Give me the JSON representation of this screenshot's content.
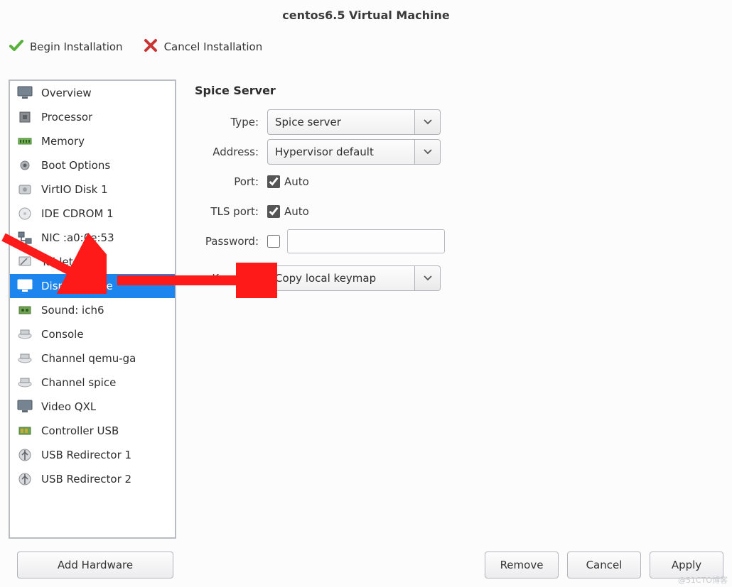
{
  "title": "centos6.5 Virtual Machine",
  "toolbar": {
    "begin_label": "Begin Installation",
    "cancel_label": "Cancel Installation"
  },
  "sidebar": {
    "items": [
      {
        "label": "Overview"
      },
      {
        "label": "Processor"
      },
      {
        "label": "Memory"
      },
      {
        "label": "Boot Options"
      },
      {
        "label": "VirtIO Disk 1"
      },
      {
        "label": "IDE CDROM 1"
      },
      {
        "label": "NIC :a0:0e:53"
      },
      {
        "label": "Tablet"
      },
      {
        "label": "Display Spice"
      },
      {
        "label": "Sound: ich6"
      },
      {
        "label": "Console"
      },
      {
        "label": "Channel qemu-ga"
      },
      {
        "label": "Channel spice"
      },
      {
        "label": "Video QXL"
      },
      {
        "label": "Controller USB"
      },
      {
        "label": "USB Redirector 1"
      },
      {
        "label": "USB Redirector 2"
      }
    ]
  },
  "panel": {
    "title": "Spice Server",
    "labels": {
      "type": "Type:",
      "address": "Address:",
      "port": "Port:",
      "tlsport": "TLS port:",
      "password": "Password:",
      "keymap": "Keymap:"
    },
    "type_value": "Spice server",
    "address_value": "Hypervisor default",
    "port_auto": "Auto",
    "tls_auto": "Auto",
    "password_value": "",
    "keymap_value": "Copy local keymap"
  },
  "footer": {
    "add_hw": "Add Hardware",
    "remove": "Remove",
    "cancel": "Cancel",
    "apply": "Apply"
  },
  "watermark": "@51CTO博客"
}
